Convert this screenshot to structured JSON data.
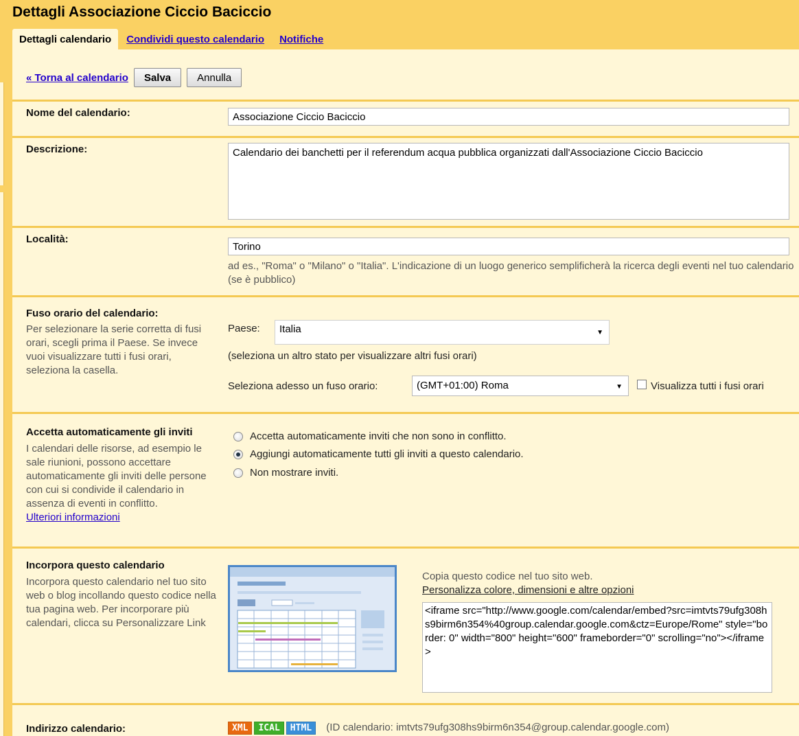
{
  "header": {
    "title": "Dettagli Associazione Ciccio Baciccio"
  },
  "tabs": [
    {
      "label": "Dettagli calendario"
    },
    {
      "label": "Condividi questo calendario"
    },
    {
      "label": "Notifiche"
    }
  ],
  "toolbar": {
    "back_link": "« Torna al calendario",
    "save_label": "Salva",
    "cancel_label": "Annulla"
  },
  "name_section": {
    "label": "Nome del calendario:",
    "value": "Associazione Ciccio Baciccio"
  },
  "description_section": {
    "label": "Descrizione:",
    "value": "Calendario dei banchetti per il referendum acqua pubblica organizzati dall'Associazione Ciccio Baciccio"
  },
  "location_section": {
    "label": "Località:",
    "value": "Torino",
    "hint": "ad es., \"Roma\" o \"Milano\" o \"Italia\". L'indicazione di un luogo generico semplificherà la ricerca degli eventi nel tuo calendario (se è pubblico)"
  },
  "timezone_section": {
    "label": "Fuso orario del calendario:",
    "description": "Per selezionare la serie corretta di fusi orari, scegli prima il Paese. Se invece vuoi visualizzare tutti i fusi orari, seleziona la casella.",
    "country_label": "Paese:",
    "country_value": "Italia",
    "country_hint": "(seleziona un altro stato per visualizzare altri fusi orari)",
    "tz_label": "Seleziona adesso un fuso orario:",
    "tz_value": "(GMT+01:00) Roma",
    "show_all_label": "Visualizza tutti i fusi orari",
    "show_all_checked": false
  },
  "invites_section": {
    "label": "Accetta automaticamente gli inviti",
    "description": "I calendari delle risorse, ad esempio le sale riunioni, possono accettare automaticamente gli inviti delle persone con cui si condivide il calendario in assenza di eventi in conflitto.",
    "more_link": "Ulteriori informazioni",
    "options": [
      {
        "label": "Accetta automaticamente inviti che non sono in conflitto.",
        "checked": false
      },
      {
        "label": "Aggiungi automaticamente tutti gli inviti a questo calendario.",
        "checked": true
      },
      {
        "label": "Non mostrare inviti.",
        "checked": false
      }
    ]
  },
  "embed_section": {
    "label": "Incorpora questo calendario",
    "description": "Incorpora questo calendario nel tuo sito web o blog incollando questo codice nella tua pagina web. Per incorporare più calendari, clicca su Personalizzare Link",
    "copy_hint": "Copia questo codice nel tuo sito web.",
    "customize_link": "Personalizza colore, dimensioni e altre opzioni",
    "code": "<iframe src=\"http://www.google.com/calendar/embed?src=imtvts79ufg308hs9birm6n354%40group.calendar.google.com&ctz=Europe/Rome\" style=\"border: 0\" width=\"800\" height=\"600\" frameborder=\"0\" scrolling=\"no\"></iframe>"
  },
  "address_section": {
    "label": "Indirizzo calendario:",
    "badges": [
      {
        "label": "XML",
        "color": "#e8690f"
      },
      {
        "label": "ICAL",
        "color": "#3fae2a"
      },
      {
        "label": "HTML",
        "color": "#3a8fd8"
      }
    ],
    "calendar_id": "(ID calendario: imtvts79ufg308hs9birm6n354@group.calendar.google.com)"
  },
  "colors": {
    "background": "#fad163",
    "panel": "#fff7d7",
    "divider": "#f4c952",
    "link": "#2200cc"
  }
}
